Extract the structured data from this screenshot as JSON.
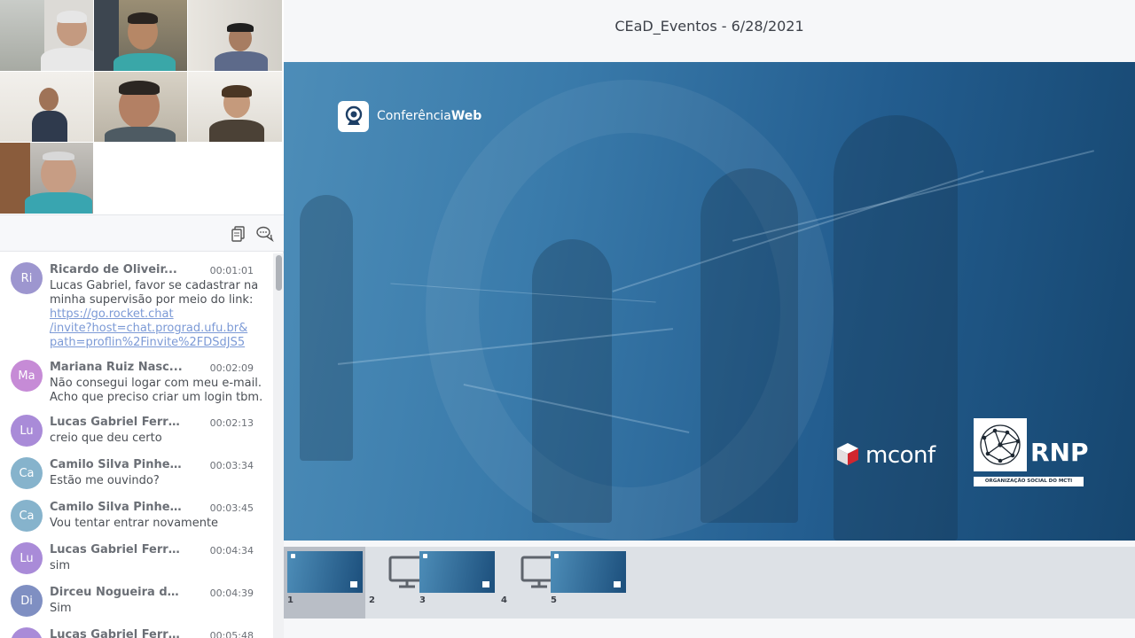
{
  "meeting": {
    "title": "CEaD_Eventos - 6/28/2021"
  },
  "colors": {
    "avatar_ri": "#9d96cf",
    "avatar_ma": "#c68bd6",
    "avatar_lu": "#a98bd8",
    "avatar_ca": "#86b3cc",
    "avatar_di": "#7f8fc2",
    "link": "#7c9ad6",
    "slide_blue": "#235d8f"
  },
  "chat_toolbar": {
    "icons": [
      "copy-icon",
      "chat-bubbles-icon"
    ]
  },
  "chat": {
    "messages": [
      {
        "initials": "Ri",
        "name": "Ricardo de Oliveir...",
        "time": "00:01:01",
        "text": "Lucas Gabriel, favor se cadastrar na minha supervisão por meio do link:",
        "link_lines": [
          "https://go.rocket.chat",
          "/invite?host=chat.prograd.ufu.br&",
          "path=proflin%2Finvite%2FDSdJS5"
        ]
      },
      {
        "initials": "Ma",
        "name": "Mariana Ruiz Nasc...",
        "time": "00:02:09",
        "text": "Não consegui logar com meu e-mail. Acho que preciso criar um login tbm."
      },
      {
        "initials": "Lu",
        "name": "Lucas Gabriel Ferreir...",
        "time": "00:02:13",
        "text": "creio que deu certo"
      },
      {
        "initials": "Ca",
        "name": "Camilo Silva Pinhe...",
        "time": "00:03:34",
        "text": "Estão me ouvindo?"
      },
      {
        "initials": "Ca",
        "name": "Camilo Silva Pinhe...",
        "time": "00:03:45",
        "text": "Vou tentar entrar novamente"
      },
      {
        "initials": "Lu",
        "name": "Lucas Gabriel Ferreir...",
        "time": "00:04:34",
        "text": "sim"
      },
      {
        "initials": "Di",
        "name": "Dirceu Nogueira de S...",
        "time": "00:04:39",
        "text": "Sim"
      },
      {
        "initials": "Lu",
        "name": "Lucas Gabriel Ferreir...",
        "time": "00:05:48",
        "text": ""
      }
    ]
  },
  "slide": {
    "logo_text_regular": "Conferência",
    "logo_text_bold": "Web",
    "mconf_text": "mconf",
    "rnp_text": "RNP",
    "rnp_subtext": "ORGANIZAÇÃO SOCIAL DO MCTI"
  },
  "thumbnails": [
    {
      "number": "1",
      "kind": "slide",
      "active": true
    },
    {
      "number": "2",
      "kind": "screen",
      "active": false
    },
    {
      "number": "3",
      "kind": "slide",
      "active": false
    },
    {
      "number": "4",
      "kind": "screen",
      "active": false
    },
    {
      "number": "5",
      "kind": "slide",
      "active": false
    }
  ]
}
